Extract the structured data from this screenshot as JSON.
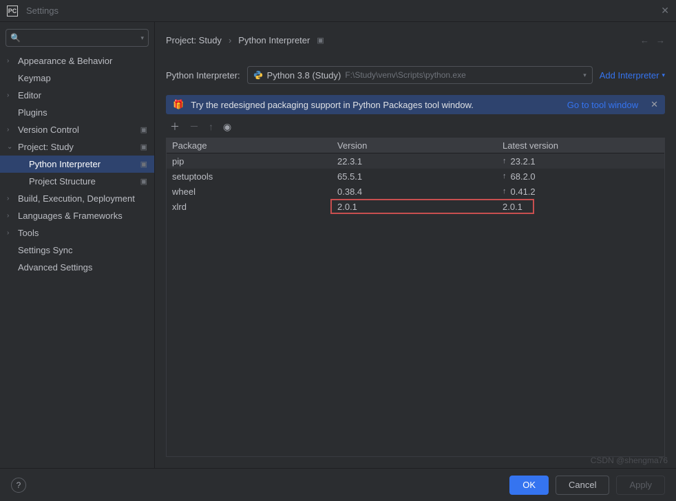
{
  "window": {
    "title": "Settings"
  },
  "sidebar": {
    "search_placeholder": "",
    "items": [
      {
        "label": "Appearance & Behavior",
        "expandable": true
      },
      {
        "label": "Keymap",
        "expandable": false
      },
      {
        "label": "Editor",
        "expandable": true
      },
      {
        "label": "Plugins",
        "expandable": false
      },
      {
        "label": "Version Control",
        "expandable": true,
        "badge": "▣"
      },
      {
        "label": "Project: Study",
        "expandable": true,
        "expanded": true,
        "badge": "▣",
        "children": [
          {
            "label": "Python Interpreter",
            "selected": true,
            "badge": "▣"
          },
          {
            "label": "Project Structure",
            "badge": "▣"
          }
        ]
      },
      {
        "label": "Build, Execution, Deployment",
        "expandable": true
      },
      {
        "label": "Languages & Frameworks",
        "expandable": true
      },
      {
        "label": "Tools",
        "expandable": true
      },
      {
        "label": "Settings Sync",
        "expandable": false
      },
      {
        "label": "Advanced Settings",
        "expandable": false
      }
    ]
  },
  "breadcrumb": {
    "items": [
      "Project: Study",
      "Python Interpreter"
    ],
    "sep": "›"
  },
  "interpreter": {
    "label": "Python Interpreter:",
    "name": "Python 3.8 (Study)",
    "path": "F:\\Study\\venv\\Scripts\\python.exe",
    "add_label": "Add Interpreter"
  },
  "banner": {
    "message": "Try the redesigned packaging support in Python Packages tool window.",
    "link": "Go to tool window"
  },
  "table": {
    "headers": {
      "package": "Package",
      "version": "Version",
      "latest": "Latest version"
    },
    "rows": [
      {
        "package": "pip",
        "version": "22.3.1",
        "latest": "23.2.1",
        "upgradable": true
      },
      {
        "package": "setuptools",
        "version": "65.5.1",
        "latest": "68.2.0",
        "upgradable": true
      },
      {
        "package": "wheel",
        "version": "0.38.4",
        "latest": "0.41.2",
        "upgradable": true
      },
      {
        "package": "xlrd",
        "version": "2.0.1",
        "latest": "2.0.1",
        "upgradable": false,
        "highlight": true
      }
    ]
  },
  "footer": {
    "ok": "OK",
    "cancel": "Cancel",
    "apply": "Apply"
  },
  "watermark": "CSDN @shengma76"
}
